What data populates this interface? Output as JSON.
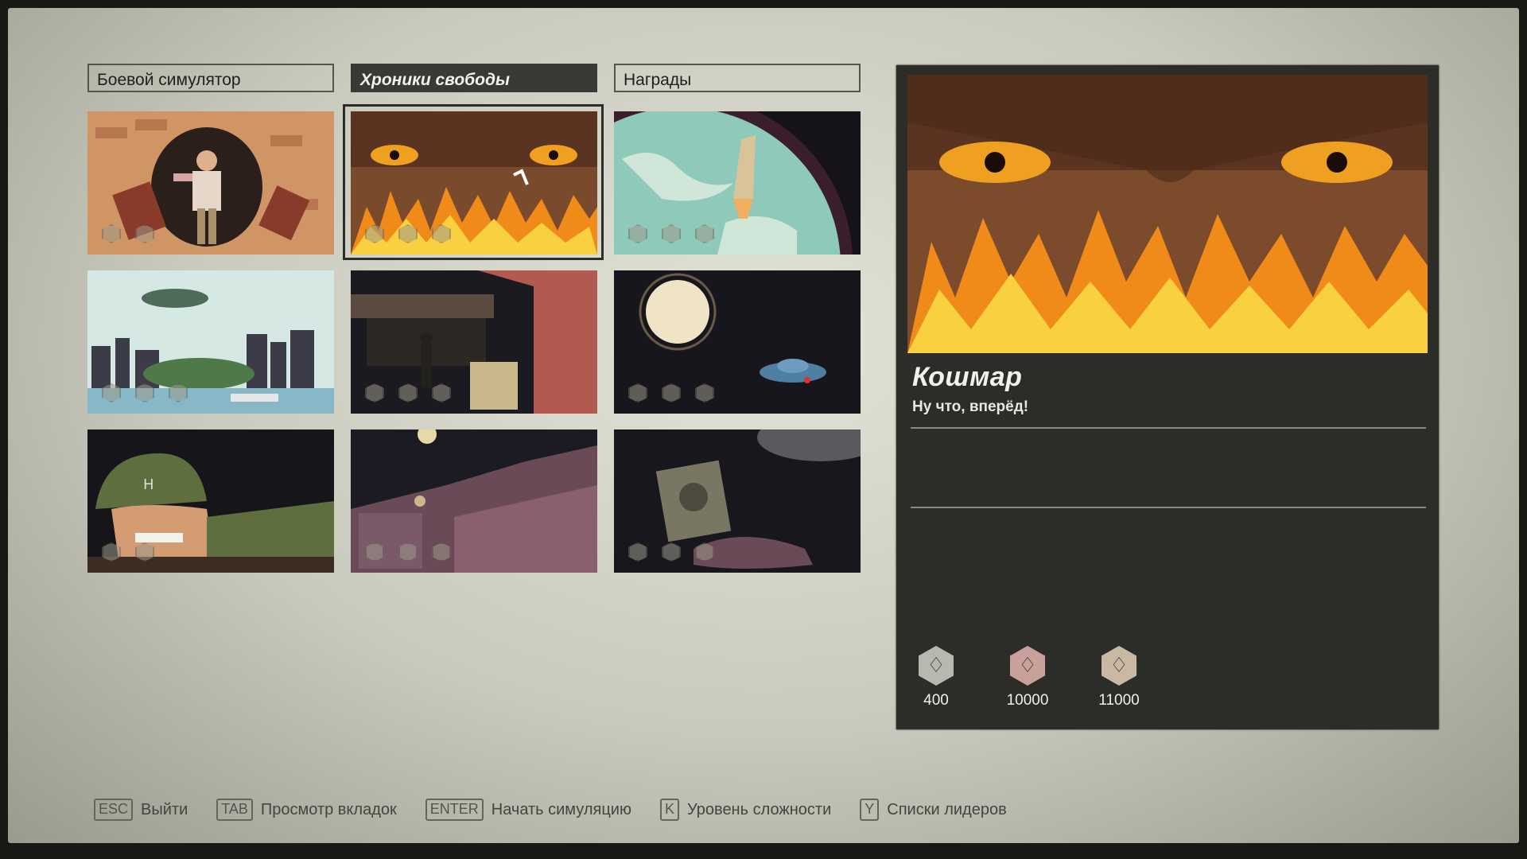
{
  "tabs": [
    {
      "label": "Боевой симулятор",
      "active": false
    },
    {
      "label": "Хроники свободы",
      "active": true
    },
    {
      "label": "Награды",
      "active": false
    }
  ],
  "grid": {
    "rows": 3,
    "cols": 3,
    "selected_index": 1,
    "tiles": [
      {
        "scene": "soldier-bursting-through-brick-wall"
      },
      {
        "scene": "angry-eyes-over-flames"
      },
      {
        "scene": "rocket-launch-from-planet"
      },
      {
        "scene": "zeppelin-over-city-skyline"
      },
      {
        "scene": "night-street-studio-entrance"
      },
      {
        "scene": "moon-and-flying-saucer"
      },
      {
        "scene": "soldier-in-helmet-close-up"
      },
      {
        "scene": "lunar-landscape-base"
      },
      {
        "scene": "space-capsule-wreck"
      }
    ]
  },
  "detail": {
    "title": "Кошмар",
    "subtitle": "Ну что, вперёд!",
    "scores": [
      {
        "value": "400",
        "tier": "silver",
        "color": "#b9b8b0"
      },
      {
        "value": "10000",
        "tier": "bronze",
        "color": "#c8a29a"
      },
      {
        "value": "11000",
        "tier": "gold",
        "color": "#c9b9a3"
      }
    ]
  },
  "hints": [
    {
      "key": "ESC",
      "label": "Выйти"
    },
    {
      "key": "TAB",
      "label": "Просмотр вкладок"
    },
    {
      "key": "ENTER",
      "label": "Начать симуляцию"
    },
    {
      "key": "K",
      "label": "Уровень сложности"
    },
    {
      "key": "Y",
      "label": "Списки лидеров"
    }
  ],
  "icons": {
    "medal": "medal-icon",
    "score_badge": "rank-badge-icon"
  }
}
